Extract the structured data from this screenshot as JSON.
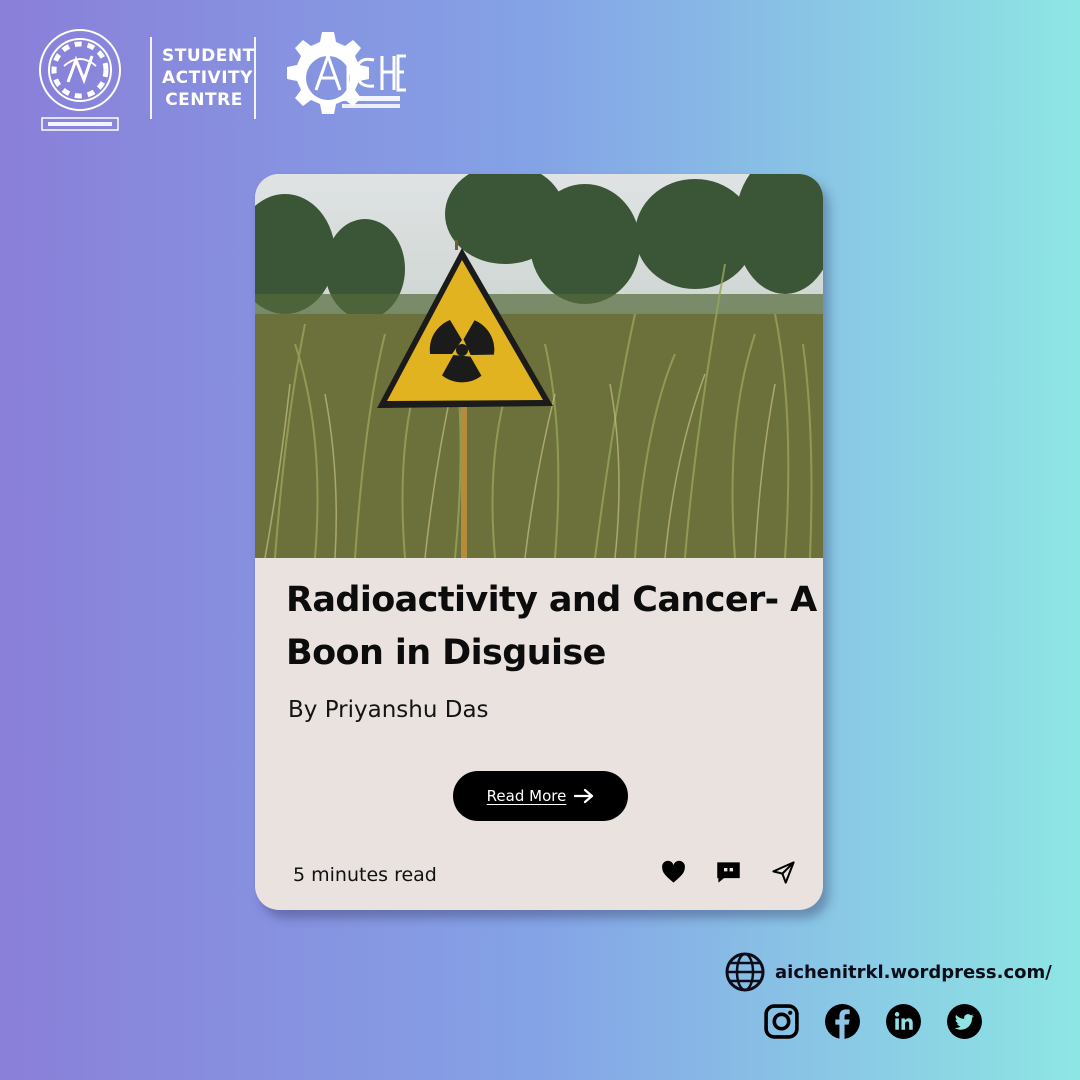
{
  "header": {
    "sac_lines": [
      "STUDENT",
      "ACTIVITY",
      "CENTRE"
    ],
    "nit_logo_text": "NATIONAL INSTITUTE OF TECHNOLOGY ROURKELA",
    "aiche_logo_text": "AIChE NIT ROURKELA STUDENT CHAPTER"
  },
  "card": {
    "title": "Radioactivity and Cancer- A Boon in Disguise",
    "author": "By Priyanshu Das",
    "read_more_label": "Read More",
    "read_time": "5 minutes read",
    "actions": [
      "heart-icon",
      "comment-icon",
      "share-icon"
    ]
  },
  "footer": {
    "website": "aichenitrkl.wordpress.com/",
    "socials": [
      "instagram-icon",
      "facebook-icon",
      "linkedin-icon",
      "twitter-icon"
    ]
  },
  "colors": {
    "bg_left": "#8a7fd9",
    "bg_mid": "#84a3e6",
    "bg_right": "#8ee6e4",
    "card_bg": "#e9e2df",
    "sign_yellow": "#e2b321",
    "button_bg": "#000000"
  }
}
